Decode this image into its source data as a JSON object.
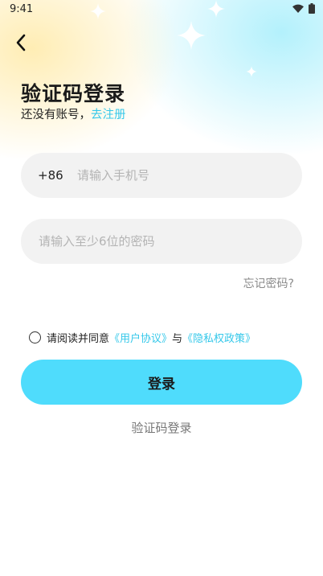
{
  "status_bar": {
    "time": "9:41",
    "icons": [
      "wifi-icon",
      "battery-icon"
    ]
  },
  "header": {
    "back_icon": "chevron-left-icon",
    "title": "验证码登录"
  },
  "subtitle": {
    "text": "还没有账号，",
    "register_link": "去注册"
  },
  "phone_field": {
    "country_code": "+86",
    "value": "",
    "placeholder": "请输入手机号"
  },
  "password_field": {
    "value": "",
    "placeholder": "请输入至少6位的密码"
  },
  "forgot_password": "忘记密码?",
  "agreement": {
    "checked": false,
    "prefix": "请阅读并同意",
    "user_agreement": "《用户协议》",
    "and": "与",
    "privacy_policy": "《隐私权政策》"
  },
  "login_button": "登录",
  "alt_login": "验证码登录",
  "colors": {
    "accent": "#4fdcfc",
    "link": "#35c8ea",
    "field_bg": "#f2f2f2"
  }
}
